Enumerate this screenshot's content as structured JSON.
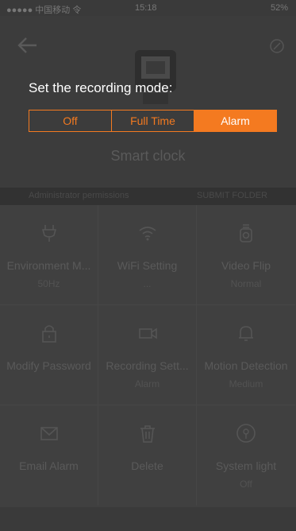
{
  "status": {
    "carrier": "●●●●● 中国移动 令",
    "time": "15:18",
    "battery": "52%"
  },
  "header": {
    "device_name": "Smart clock"
  },
  "subbar": {
    "left": "Administrator permissions",
    "right": "SUBMIT FOLDER"
  },
  "dialog": {
    "title": "Set the recording mode:",
    "options": [
      "Off",
      "Full Time",
      "Alarm"
    ],
    "selected": "Alarm",
    "accent": "#f47a20"
  },
  "grid": [
    {
      "icon": "plug-icon",
      "title": "Environment M...",
      "value": "50Hz"
    },
    {
      "icon": "wifi-icon",
      "title": "WiFi Setting",
      "value": "..."
    },
    {
      "icon": "camera-flip-icon",
      "title": "Video Flip",
      "value": "Normal"
    },
    {
      "icon": "lock-icon",
      "title": "Modify Password",
      "value": ""
    },
    {
      "icon": "video-camera-icon",
      "title": "Recording Sett...",
      "value": "Alarm"
    },
    {
      "icon": "bell-icon",
      "title": "Motion Detection",
      "value": "Medium"
    },
    {
      "icon": "envelope-icon",
      "title": "Email Alarm",
      "value": ""
    },
    {
      "icon": "trash-icon",
      "title": "Delete",
      "value": ""
    },
    {
      "icon": "light-icon",
      "title": "System light",
      "value": "Off"
    }
  ]
}
